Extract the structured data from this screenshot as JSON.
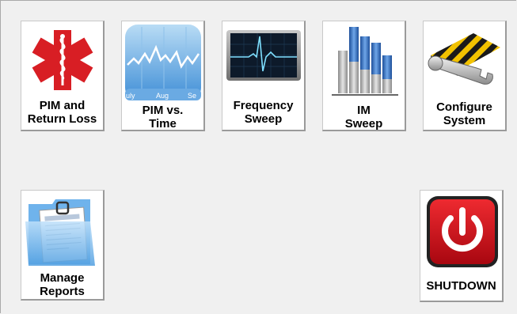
{
  "tiles": [
    {
      "line1": "PIM and",
      "line2": "Return Loss",
      "icon": "medical-star-icon"
    },
    {
      "line1": "PIM vs.",
      "line2": "Time",
      "icon": "stocks-chart-icon",
      "months": [
        "uly",
        "Aug",
        "Se"
      ]
    },
    {
      "line1": "Frequency",
      "line2": "Sweep",
      "icon": "waveform-monitor-icon"
    },
    {
      "line1": "IM",
      "line2": "Sweep",
      "icon": "bar-graph-3d-icon"
    },
    {
      "line1": "Configure",
      "line2": "System",
      "icon": "tools-wrench-icon"
    },
    {
      "line1": "Manage",
      "line2": "Reports",
      "icon": "reports-folder-icon"
    },
    {
      "line1": "SHUTDOWN",
      "icon": "power-icon"
    }
  ],
  "colors": {
    "medical_red": "#d81e24",
    "shutdown_red": "#d0111a",
    "background": "#f0f0f0"
  }
}
